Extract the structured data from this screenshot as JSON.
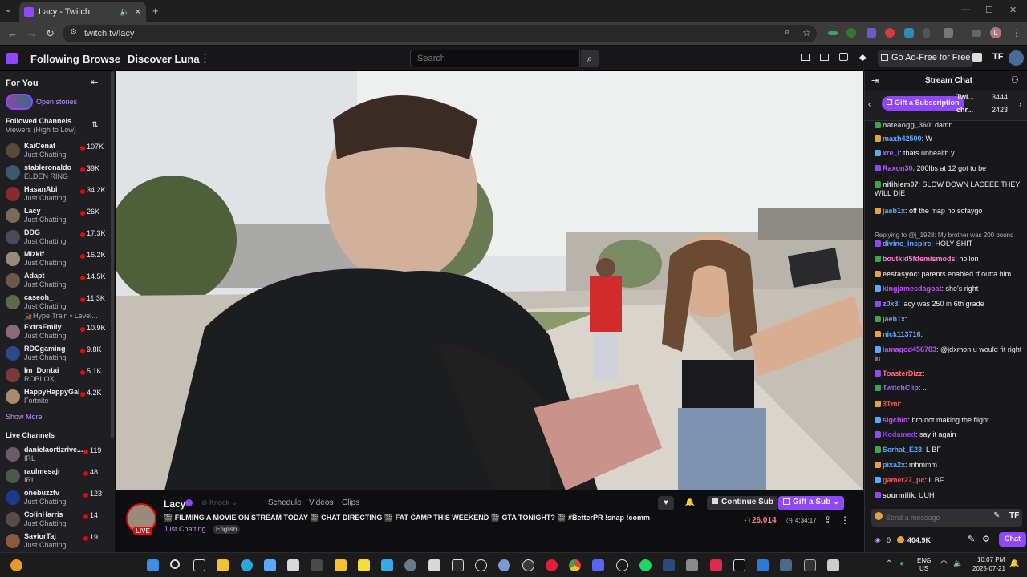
{
  "browser": {
    "tab_title": "Lacy - Twitch",
    "url": "twitch.tv/lacy",
    "profile_initial": "L"
  },
  "topnav": {
    "following": "Following",
    "browse": "Browse",
    "discover": "Discover Luna",
    "search_placeholder": "Search",
    "ad_free": "Go Ad-Free for Free"
  },
  "sidebar": {
    "for_you": "For You",
    "open_stories": "Open stories",
    "followed_heading": "Followed Channels",
    "sort_label": "Viewers (High to Low)",
    "followed": [
      {
        "name": "KaiCenat",
        "game": "Just Chatting",
        "viewers": "107K",
        "color": "#5a4a3a"
      },
      {
        "name": "stableronaldo",
        "game": "ELDEN RING",
        "viewers": "39K",
        "color": "#3a5a6a"
      },
      {
        "name": "HasanAbi",
        "game": "Just Chatting",
        "viewers": "34.2K",
        "color": "#8a2a2a"
      },
      {
        "name": "Lacy",
        "game": "Just Chatting",
        "viewers": "26K",
        "color": "#7a6a5a"
      },
      {
        "name": "DDG",
        "game": "Just Chatting",
        "viewers": "17.3K",
        "color": "#4a4a5a"
      },
      {
        "name": "Mizkif",
        "game": "Just Chatting",
        "viewers": "16.2K",
        "color": "#9a8a7a"
      },
      {
        "name": "Adapt",
        "game": "Just Chatting",
        "viewers": "14.5K",
        "color": "#6a5a4a"
      },
      {
        "name": "caseoh_",
        "game": "Just Chatting",
        "viewers": "11.3K",
        "color": "#5a6a4a"
      },
      {
        "name": "ExtraEmily",
        "game": "Just Chatting",
        "viewers": "10.9K",
        "color": "#8a6a7a"
      },
      {
        "name": "RDCgaming",
        "game": "Just Chatting",
        "viewers": "9.8K",
        "color": "#2a4a8a"
      },
      {
        "name": "Im_Dontai",
        "game": "ROBLOX",
        "viewers": "5.1K",
        "color": "#7a3a3a"
      },
      {
        "name": "HappyHappyGal",
        "game": "Fortnite",
        "viewers": "4.2K",
        "color": "#aa8a6a"
      }
    ],
    "hype_train": "Hype Train • Level...",
    "show_more": "Show More",
    "live_heading": "Live Channels",
    "live": [
      {
        "name": "danielaortizrive...",
        "game": "IRL",
        "viewers": "119",
        "color": "#6a5a6a"
      },
      {
        "name": "raulmesajr",
        "game": "IRL",
        "viewers": "48",
        "color": "#4a5a4a"
      },
      {
        "name": "onebuzztv",
        "game": "Just Chatting",
        "viewers": "123",
        "color": "#1a3a8a"
      },
      {
        "name": "ColinHarris",
        "game": "Just Chatting",
        "viewers": "14",
        "color": "#5a4a4a"
      },
      {
        "name": "SaviorTaj",
        "game": "Just Chatting",
        "viewers": "19",
        "color": "#8a5a3a"
      }
    ]
  },
  "stream": {
    "streamer": "Lacy",
    "live_badge": "LIVE",
    "knock": "Knock",
    "tabs": [
      "Schedule",
      "Videos",
      "Clips"
    ],
    "title": "🎬 FILMING A MOVIE ON STREAM TODAY 🎬 CHAT DIRECTING 🎬 FAT CAMP THIS WEEKEND 🎬 GTA TONIGHT? 🎬 #BetterPR !snap !comm",
    "category": "Just Chatting",
    "language": "English",
    "continue_sub": "Continue Sub",
    "gift_sub": "Gift a Sub",
    "viewer_count": "26,014",
    "uptime": "4:34:17"
  },
  "chat": {
    "header": "Stream Chat",
    "gift_subscription": "Gift a Subscription",
    "leaderboard": [
      {
        "name": "Twi...",
        "count": "3444"
      },
      {
        "name": "chr...",
        "count": "2423"
      }
    ],
    "messages": [
      {
        "user": "nateaogg_360",
        "text": ": damn",
        "color": "#adadb8"
      },
      {
        "user": "maxh42500",
        "text": ": W",
        "color": "#5fa8ff"
      },
      {
        "user": "xre_i",
        "text": ": thats unhealth y",
        "color": "#9d6cff"
      },
      {
        "user": "Raxon30",
        "text": ": 200lbs at 12 got to be",
        "color": "#c44cff"
      },
      {
        "user": "nifihiem07",
        "text": ": SLOW DOWN LACEEE THEY WILL DIE",
        "color": "#d1d1d1"
      },
      {
        "user": "jaeb1x",
        "text": ": off the map no sofaygo",
        "color": "#5fa8ff"
      },
      {
        "user": "reply",
        "text": "Replying to @j_1928: My brother was 200 pound",
        "color": "#adadb8"
      },
      {
        "user": "divine_inspire",
        "text": ": HOLY SHIT",
        "color": "#5fa8ff"
      },
      {
        "user": "boutkid5fdemismods",
        "text": ": hollon",
        "color": "#ff7ad9"
      },
      {
        "user": "eestasyoc",
        "text": ": parents enabled tf outta him",
        "color": "#d1d1d1"
      },
      {
        "user": "kingjamesdagoat",
        "text": ": she's right",
        "color": "#c44cff"
      },
      {
        "user": "z0x3",
        "text": ": lacy was 250 in 6th grade",
        "color": "#5fa8ff"
      },
      {
        "user": "jaeb1x",
        "text": ":",
        "color": "#5fa8ff"
      },
      {
        "user": "nick113716",
        "text": ":",
        "color": "#5fa8ff"
      },
      {
        "user": "iamagod456783",
        "text": ": @jdxmon u would fit right in",
        "color": "#c44cff"
      },
      {
        "user": "ToasterDizz",
        "text": ":",
        "color": "#ff6b6b"
      },
      {
        "user": "TwitchClip",
        "text": ": ..",
        "color": "#9d6cff"
      },
      {
        "user": "3Tmi",
        "text": ":",
        "color": "#ff4f4f"
      },
      {
        "user": "sigchid",
        "text": ": bro not making the flight",
        "color": "#c44cff"
      },
      {
        "user": "Kodamed",
        "text": ": say it again",
        "color": "#9d3cff"
      },
      {
        "user": "Serhat_E23",
        "text": ": L BF",
        "color": "#5fa8ff"
      },
      {
        "user": "pixa2x",
        "text": ": mhmmm",
        "color": "#5fa8ff"
      },
      {
        "user": "gamer27_pc",
        "text": ": L BF",
        "color": "#ff4f4f"
      },
      {
        "user": "sourmilik",
        "text": ": UUH",
        "color": "#d1d1d1"
      }
    ],
    "send_placeholder": "Send a message",
    "points_zero": "0",
    "points": "404.9K",
    "chat_button": "Chat"
  },
  "taskbar": {
    "lang": "ENG",
    "region": "US",
    "time": "10:07 PM",
    "date": "2025-07-21"
  }
}
